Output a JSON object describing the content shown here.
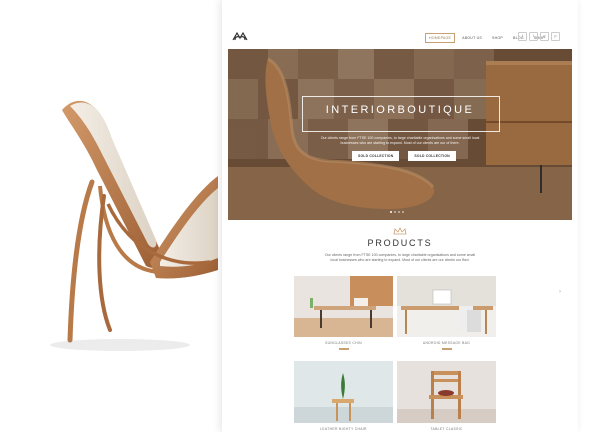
{
  "site": {
    "nav": [
      "HOMEPAGE",
      "ABOUT US",
      "SHOP",
      "BLOG",
      "SHOP"
    ],
    "active_nav": "HOMEPAGE",
    "socials": [
      "f",
      "t",
      "g",
      "p"
    ]
  },
  "hero": {
    "title": "INTERIORBOUTIQUE",
    "text": "Our clients range from FTSE 100 companies, to large charitable organisations and some small local businesses who are starting to expand. Most of our clients are our of there.",
    "buttons": [
      "SOLD COLLECTION",
      "SOLD COLLECTION"
    ],
    "slides": 4,
    "active_slide": 1
  },
  "products": {
    "title": "PRODUCTS",
    "subtitle": "Our clients range from FTSE 100 companies, to large charitable organisations and some small local businesses who are starting to expand. Most of our clients are our clients our Bed.",
    "arrow": "›",
    "items": [
      {
        "name": "SUNGLASSES CHIN"
      },
      {
        "name": "ANDROID MESSAGE BAG"
      },
      {
        "name": "LEATHER NIGHTY CHAIR"
      },
      {
        "name": "TABLET CLASSIC"
      }
    ]
  },
  "colors": {
    "accent": "#c8a072",
    "wood": "#b9835a"
  }
}
